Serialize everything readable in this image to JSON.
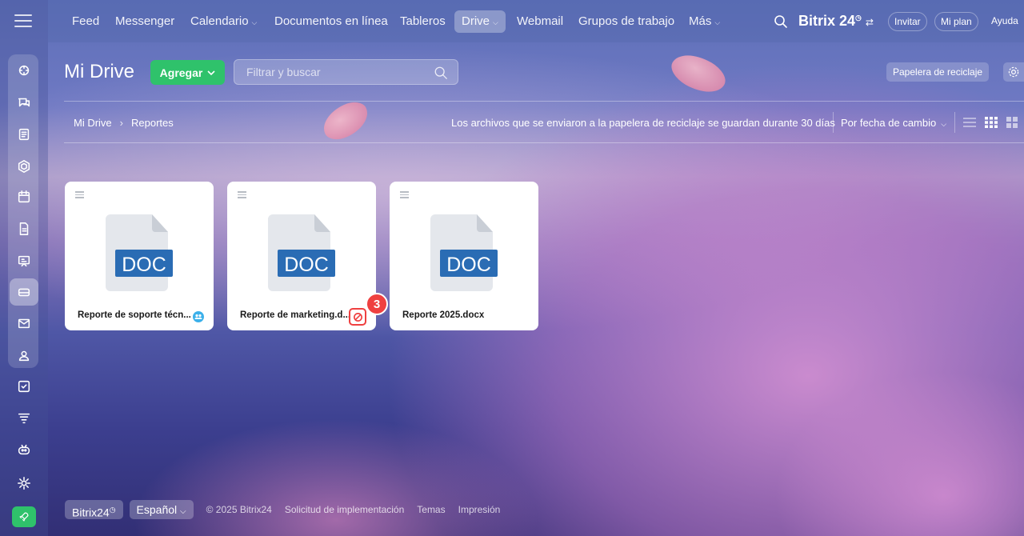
{
  "nav": {
    "items": [
      {
        "label": "Feed",
        "caret": false
      },
      {
        "label": "Messenger",
        "caret": false
      },
      {
        "label": "Calendario",
        "caret": true
      },
      {
        "label": "Documentos en línea",
        "caret": false
      },
      {
        "label": "Tableros",
        "caret": false
      },
      {
        "label": "Drive",
        "caret": true,
        "active": true
      },
      {
        "label": "Webmail",
        "caret": false
      },
      {
        "label": "Grupos de trabajo",
        "caret": false
      },
      {
        "label": "Más",
        "caret": true
      }
    ],
    "logo": "Bitrix 24",
    "invite_label": "Invitar",
    "plan_label": "Mi plan",
    "help_label": "Ayuda"
  },
  "sidebar": {
    "icons": [
      "activity-icon",
      "chat-icon",
      "news-icon",
      "hexagon-icon",
      "calendar-icon",
      "document-icon",
      "boards-icon",
      "drive-icon",
      "mail-icon",
      "contacts-icon",
      "tasks-icon",
      "funnel-icon",
      "robot-icon",
      "settings-icon",
      "rocket-icon"
    ]
  },
  "header": {
    "title": "Mi Drive",
    "add_label": "Agregar",
    "search_placeholder": "Filtrar y buscar",
    "recycle_label": "Papelera de reciclaje"
  },
  "toolbar": {
    "breadcrumb": [
      "Mi Drive",
      "Reportes"
    ],
    "notice": "Los archivos que se enviaron a la papelera de reciclaje se guardan durante 30 días",
    "sort_label": "Por fecha de cambio"
  },
  "files": [
    {
      "name": "Reporte de soporte técn...",
      "type_label": "DOC",
      "badge": "shared"
    },
    {
      "name": "Reporte de marketing.d...",
      "type_label": "DOC",
      "badge": "locked"
    },
    {
      "name": "Reporte 2025.docx",
      "type_label": "DOC",
      "badge": "none"
    }
  ],
  "step_marker": "3",
  "footer": {
    "brand": "Bitrix24",
    "language": "Español",
    "copyright": "© 2025 Bitrix24",
    "links": [
      "Solicitud de implementación",
      "Temas",
      "Impresión"
    ]
  },
  "colors": {
    "accent_green": "#2fc26b",
    "doc_blue": "#2a6cb4",
    "alert_red": "#ef4040",
    "share_blue": "#3bb0ea"
  }
}
